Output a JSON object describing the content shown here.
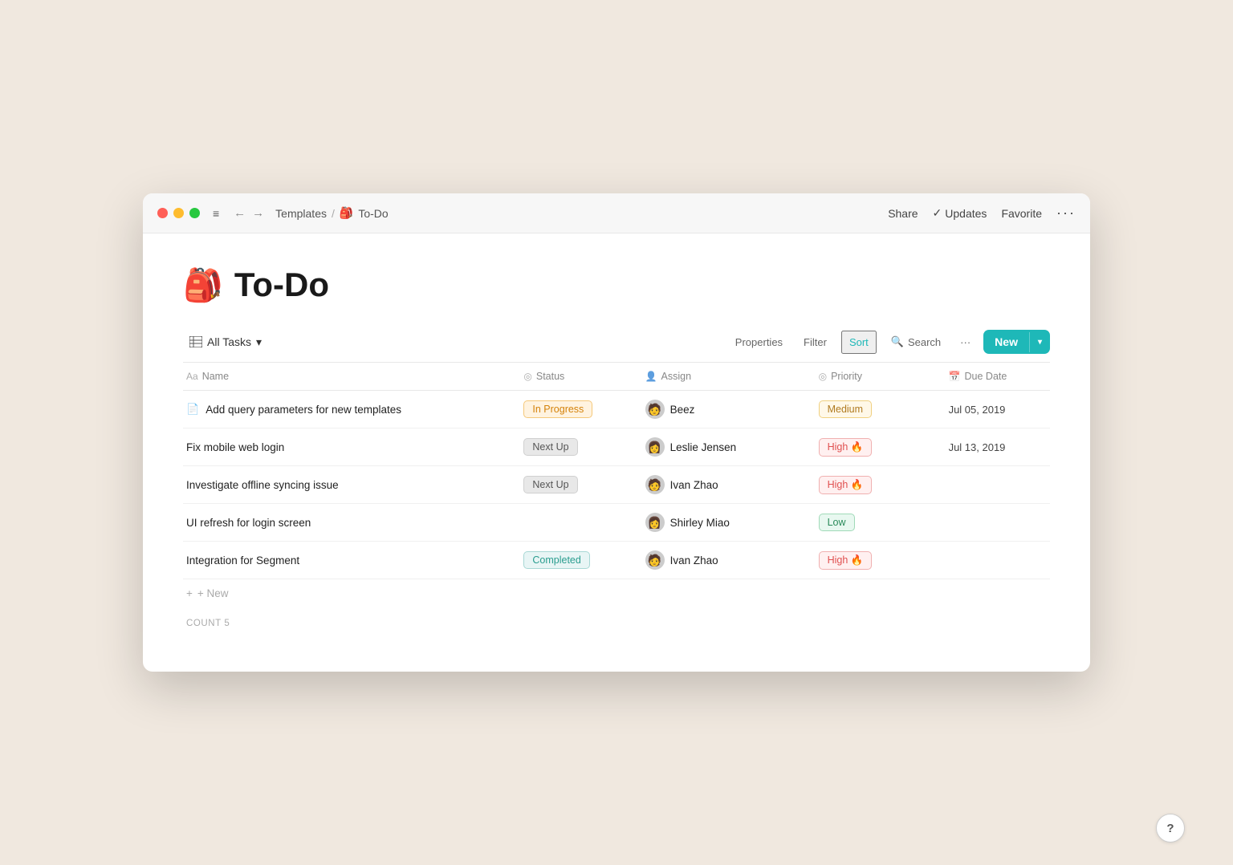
{
  "titlebar": {
    "breadcrumb_parent": "Templates",
    "breadcrumb_sep": "/",
    "breadcrumb_current": "To-Do",
    "breadcrumb_emoji": "🎒",
    "share_label": "Share",
    "updates_check": "✓",
    "updates_label": "Updates",
    "favorite_label": "Favorite",
    "more_label": "···",
    "menu_icon": "≡",
    "nav_back": "←",
    "nav_fwd": "→"
  },
  "page": {
    "emoji": "🎒",
    "title": "To-Do"
  },
  "toolbar": {
    "all_tasks_label": "All Tasks",
    "properties_label": "Properties",
    "filter_label": "Filter",
    "sort_label": "Sort",
    "search_label": "Search",
    "more_label": "···",
    "new_label": "New",
    "chevron": "▾"
  },
  "columns": [
    {
      "id": "name",
      "label": "Name",
      "icon": "Aa"
    },
    {
      "id": "status",
      "label": "Status",
      "icon": "◎"
    },
    {
      "id": "assign",
      "label": "Assign",
      "icon": "👤"
    },
    {
      "id": "priority",
      "label": "Priority",
      "icon": "◎"
    },
    {
      "id": "due_date",
      "label": "Due Date",
      "icon": "📅"
    }
  ],
  "tasks": [
    {
      "id": 1,
      "name": "Add query parameters for new templates",
      "has_doc_icon": true,
      "status": "In Progress",
      "status_type": "inprogress",
      "assign": "Beez",
      "assign_avatar": "🧑",
      "priority": "Medium",
      "priority_type": "medium",
      "priority_emoji": "",
      "due_date": "Jul 05, 2019"
    },
    {
      "id": 2,
      "name": "Fix mobile web login",
      "has_doc_icon": false,
      "status": "Next Up",
      "status_type": "nextup",
      "assign": "Leslie Jensen",
      "assign_avatar": "👩",
      "priority": "High 🔥",
      "priority_type": "high",
      "priority_emoji": "🔥",
      "due_date": "Jul 13, 2019"
    },
    {
      "id": 3,
      "name": "Investigate offline syncing issue",
      "has_doc_icon": false,
      "status": "Next Up",
      "status_type": "nextup",
      "assign": "Ivan Zhao",
      "assign_avatar": "🧑",
      "priority": "High 🔥",
      "priority_type": "high",
      "priority_emoji": "🔥",
      "due_date": ""
    },
    {
      "id": 4,
      "name": "UI refresh for login screen",
      "has_doc_icon": false,
      "status": "",
      "status_type": "none",
      "assign": "Shirley Miao",
      "assign_avatar": "👩",
      "priority": "Low",
      "priority_type": "low",
      "priority_emoji": "",
      "due_date": ""
    },
    {
      "id": 5,
      "name": "Integration for Segment",
      "has_doc_icon": false,
      "status": "Completed",
      "status_type": "completed",
      "assign": "Ivan Zhao",
      "assign_avatar": "🧑",
      "priority": "High 🔥",
      "priority_type": "high",
      "priority_emoji": "🔥",
      "due_date": ""
    }
  ],
  "add_new_label": "+ New",
  "count_label": "COUNT",
  "count_value": "5",
  "help_label": "?"
}
